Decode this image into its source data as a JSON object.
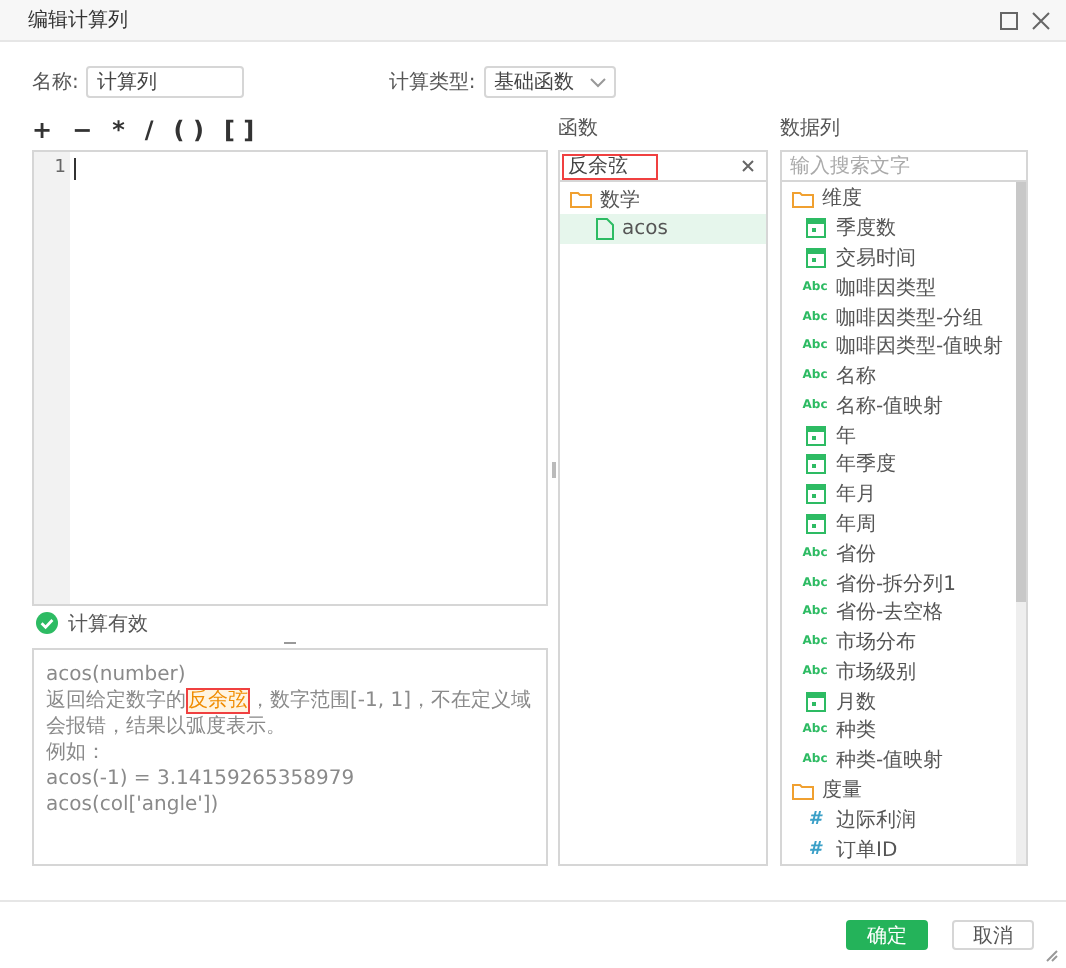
{
  "window": {
    "title": "编辑计算列"
  },
  "name_field": {
    "label": "名称:",
    "value": "计算列"
  },
  "calc_type": {
    "label": "计算类型:",
    "value": "基础函数"
  },
  "operators": [
    "+",
    "−",
    "*",
    "/",
    "( )",
    "[ ]"
  ],
  "editor": {
    "line_numbers": [
      "1"
    ]
  },
  "validation": {
    "valid": true,
    "message": "计算有效"
  },
  "description": {
    "lines": [
      "acos(number)",
      "返回给定数字的**反余弦**，数字范围[-1, 1]，不在定义域会报错，结果以弧度表示。",
      "例如：",
      "acos(-1) = 3.14159265358979",
      "acos(col['angle'])"
    ]
  },
  "functions": {
    "title": "函数",
    "search": {
      "value": "反余弦",
      "highlight": true
    },
    "tree": [
      {
        "label": "数学",
        "expanded": true,
        "children": [
          {
            "label": "acos",
            "selected": true
          }
        ]
      }
    ]
  },
  "columns": {
    "title": "数据列",
    "search": {
      "placeholder": "输入搜索文字"
    },
    "groups": [
      {
        "label": "维度",
        "expanded": true,
        "children": [
          {
            "kind": "date",
            "label": "季度数"
          },
          {
            "kind": "date",
            "label": "交易时间"
          },
          {
            "kind": "text",
            "badge": "Abc",
            "label": "咖啡因类型"
          },
          {
            "kind": "text",
            "badge": "Abc",
            "label": "咖啡因类型-分组"
          },
          {
            "kind": "text",
            "badge": "Abc",
            "label": "咖啡因类型-值映射"
          },
          {
            "kind": "text",
            "badge": "Abc",
            "label": "名称"
          },
          {
            "kind": "text",
            "badge": "Abc",
            "label": "名称-值映射"
          },
          {
            "kind": "date",
            "label": "年"
          },
          {
            "kind": "date",
            "label": "年季度"
          },
          {
            "kind": "date",
            "label": "年月"
          },
          {
            "kind": "date",
            "label": "年周"
          },
          {
            "kind": "text",
            "badge": "Abc",
            "label": "省份"
          },
          {
            "kind": "text",
            "badge": "Abc",
            "label": "省份-拆分列1"
          },
          {
            "kind": "text",
            "badge": "Abc",
            "label": "省份-去空格"
          },
          {
            "kind": "text",
            "badge": "Abc",
            "label": "市场分布"
          },
          {
            "kind": "text",
            "badge": "Abc",
            "label": "市场级别"
          },
          {
            "kind": "date",
            "label": "月数"
          },
          {
            "kind": "text",
            "badge": "Abc",
            "label": "种类"
          },
          {
            "kind": "text",
            "badge": "Abc",
            "label": "种类-值映射"
          }
        ]
      },
      {
        "label": "度量",
        "expanded": true,
        "children": [
          {
            "kind": "number",
            "badge": "#",
            "label": "边际利润"
          },
          {
            "kind": "number",
            "badge": "#",
            "label": "订单ID"
          }
        ]
      }
    ]
  },
  "buttons": [
    {
      "label": "确定",
      "kind": "primary"
    },
    {
      "label": "取消",
      "kind": "secondary"
    }
  ]
}
